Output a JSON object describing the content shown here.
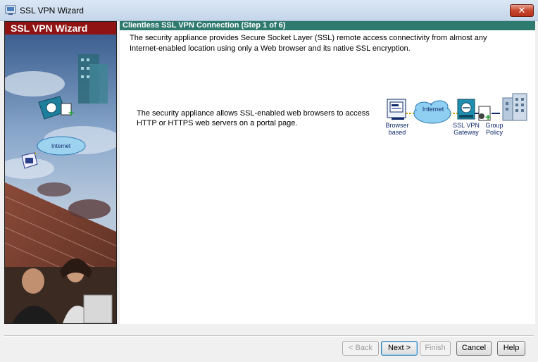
{
  "window": {
    "title": "SSL VPN Wizard",
    "close_glyph": "✕"
  },
  "sidebar": {
    "title": "SSL VPN Wizard"
  },
  "step": {
    "header": "Clientless SSL VPN Connection  (Step 1 of 6)",
    "intro": "The security appliance provides Secure Socket Layer (SSL) remote access connectivity from almost any Internet-enabled location using only a Web browser and its native SSL encryption.",
    "description": "The security appliance allows SSL-enabled web browsers to access HTTP or HTTPS web servers on a portal page."
  },
  "diagram": {
    "browser_label_1": "Browser",
    "browser_label_2": "based",
    "internet_label": "Internet",
    "gateway_label_1": "SSL VPN",
    "gateway_label_2": "Gateway",
    "policy_label_1": "Group",
    "policy_label_2": "Policy"
  },
  "buttons": {
    "back": "< Back",
    "next": "Next >",
    "finish": "Finish",
    "cancel": "Cancel",
    "help": "Help"
  },
  "colors": {
    "sidebar_header": "#8f1313",
    "step_header": "#2f7a6e",
    "diagram_label": "#10296b"
  }
}
